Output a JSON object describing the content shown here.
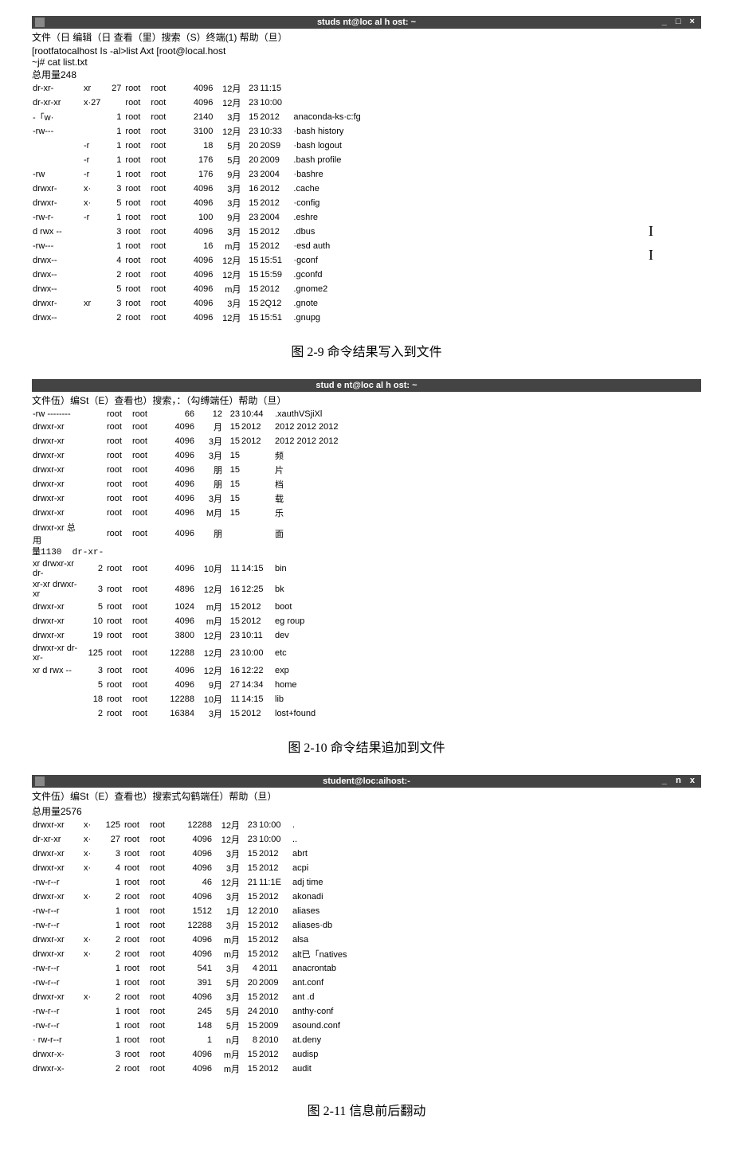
{
  "figure1": {
    "titlebar": "studs nt@loc al h ost: ~",
    "right_icons": "_ □ ×",
    "menubar": "文件（日  编辑（日  查看（里）搜索（S）终端(1)  帮助（旦）",
    "cmd1": "[rootfatocalhost Is -al>list Axt [root@local.host",
    "cmd2": "~j# cat list.txt",
    "total": "总用量248",
    "rows": [
      {
        "perm": "dr-xr-",
        "dot": "xr",
        "lnk": "27",
        "own": "root",
        "grp": "root",
        "size": "4096",
        "mon": "12月",
        "day": "23",
        "time": "11:15",
        "name": ""
      },
      {
        "perm": "dr-xr-xr",
        "dot": "x·27",
        "lnk": "",
        "own": "root",
        "grp": "root",
        "size": "4096",
        "mon": "12月",
        "day": "23",
        "time": "10:00",
        "name": ""
      },
      {
        "perm": "-「w·",
        "dot": "",
        "lnk": "1",
        "own": "root",
        "grp": "root",
        "size": "2140",
        "mon": "3月",
        "day": "15",
        "time": "2012",
        "name": "anaconda-ks·c:fg"
      },
      {
        "perm": "-rw---",
        "dot": "",
        "lnk": "1",
        "own": "root",
        "grp": "root",
        "size": "3100",
        "mon": "12月",
        "day": "23",
        "time": "10:33",
        "name": "·bash history"
      },
      {
        "perm": "",
        "dot": "-r",
        "lnk": "1",
        "own": "root",
        "grp": "root",
        "size": "18",
        "mon": "5月",
        "day": "20",
        "time": "20S9",
        "name": "·bash logout"
      },
      {
        "perm": "",
        "dot": "-r",
        "lnk": "1",
        "own": "root",
        "grp": "root",
        "size": "176",
        "mon": "5月",
        "day": "20",
        "time": "2009",
        "name": ".bash profile"
      },
      {
        "perm": "-rw",
        "dot": "-r",
        "lnk": "1",
        "own": "root",
        "grp": "root",
        "size": "176",
        "mon": "9月",
        "day": "23",
        "time": "2004",
        "name": "·bashre"
      },
      {
        "perm": "drwxr-",
        "dot": "x·",
        "lnk": "3",
        "own": "root",
        "grp": "root",
        "size": "4096",
        "mon": "3月",
        "day": "16",
        "time": "2012",
        "name": ".cache"
      },
      {
        "perm": "drwxr-",
        "dot": "x·",
        "lnk": "5",
        "own": "root",
        "grp": "root",
        "size": "4096",
        "mon": "3月",
        "day": "15",
        "time": "2012",
        "name": "·config"
      },
      {
        "perm": "-rw-r-",
        "dot": "-r",
        "lnk": "1",
        "own": "root",
        "grp": "root",
        "size": "100",
        "mon": "9月",
        "day": "23",
        "time": "2004",
        "name": ".eshre"
      },
      {
        "perm": "d rwx --",
        "dot": "",
        "lnk": "3",
        "own": "root",
        "grp": "root",
        "size": "4096",
        "mon": "3月",
        "day": "15",
        "time": "2012",
        "name": ".dbus"
      },
      {
        "perm": "-rw---",
        "dot": "",
        "lnk": "1",
        "own": "root",
        "grp": "root",
        "size": "16",
        "mon": "m月",
        "day": "15",
        "time": "2012",
        "name": "·esd auth"
      },
      {
        "perm": "drwx--",
        "dot": "",
        "lnk": "4",
        "own": "root",
        "grp": "root",
        "size": "4096",
        "mon": "12月",
        "day": "15",
        "time": "15:51",
        "name": "·gconf"
      },
      {
        "perm": "drwx--",
        "dot": "",
        "lnk": "2",
        "own": "root",
        "grp": "root",
        "size": "4096",
        "mon": "12月",
        "day": "15",
        "time": "15:59",
        "name": ".gconfd"
      },
      {
        "perm": "drwx--",
        "dot": "",
        "lnk": "5",
        "own": "root",
        "grp": "root",
        "size": "4096",
        "mon": "m月",
        "day": "15",
        "time": "2012",
        "name": ".gnome2"
      },
      {
        "perm": "drwxr-",
        "dot": "xr",
        "lnk": "3",
        "own": "root",
        "grp": "root",
        "size": "4096",
        "mon": "3月",
        "day": "15",
        "time": "2Q12",
        "name": ".gnote"
      },
      {
        "perm": "drwx--",
        "dot": "",
        "lnk": "2",
        "own": "root",
        "grp": "root",
        "size": "4096",
        "mon": "12月",
        "day": "15",
        "time": "15:51",
        "name": ".gnupg"
      }
    ],
    "caption": "图 2-9 命令结果写入到文件"
  },
  "figure2": {
    "titlebar": "stud e nt@loc al h ost: ~",
    "menubar": "文件伍）编St（E）查看也）搜索，：（勾缚端任）帮助（旦）",
    "rows_a": [
      {
        "perm": "-rw --------",
        "lnk": "",
        "own": "root",
        "grp": "root",
        "size": "66",
        "mon": "12",
        "day": "23",
        "time": "10:44",
        "name": ".xauthVSjiXl"
      },
      {
        "perm": "drwxr-xr",
        "lnk": "",
        "own": "root",
        "grp": "root",
        "size": "4096",
        "mon": "月",
        "day": "15",
        "time": "2012",
        "name": "2012 2012 2012"
      },
      {
        "perm": "drwxr-xr",
        "lnk": "",
        "own": "root",
        "grp": "root",
        "size": "4096",
        "mon": "3月",
        "day": "15",
        "time": "2012",
        "name": "2012 2012 2012"
      },
      {
        "perm": "drwxr-xr",
        "lnk": "",
        "own": "root",
        "grp": "root",
        "size": "4096",
        "mon": "3月",
        "day": "15",
        "time": "",
        "name": "频"
      },
      {
        "perm": "drwxr-xr",
        "lnk": "",
        "own": "root",
        "grp": "root",
        "size": "4096",
        "mon": "朋",
        "day": "15",
        "time": "",
        "name": "片"
      },
      {
        "perm": "drwxr-xr",
        "lnk": "",
        "own": "root",
        "grp": "root",
        "size": "4096",
        "mon": "朋",
        "day": "15",
        "time": "",
        "name": "档"
      },
      {
        "perm": "drwxr-xr",
        "lnk": "",
        "own": "root",
        "grp": "root",
        "size": "4096",
        "mon": "3月",
        "day": "15",
        "time": "",
        "name": "载"
      },
      {
        "perm": "drwxr-xr",
        "lnk": "",
        "own": "root",
        "grp": "root",
        "size": "4096",
        "mon": "M月",
        "day": "15",
        "time": "",
        "name": "乐"
      },
      {
        "perm": "drwxr-xr 总用",
        "lnk": "",
        "own": "root",
        "grp": "root",
        "size": "4096",
        "mon": "朋",
        "day": "",
        "time": "",
        "name": "面"
      }
    ],
    "mid_line": "量1130  dr-xr-",
    "rows_b": [
      {
        "perm": "xr drwxr-xr dr-",
        "lnk": "2",
        "own": "root",
        "grp": "root",
        "size": "4096",
        "mon": "10月",
        "day": "11",
        "time": "14:15",
        "name": "bin"
      },
      {
        "perm": "xr-xr  drwxr-xr",
        "lnk": "3",
        "own": "root",
        "grp": "root",
        "size": "4896",
        "mon": "12月",
        "day": "16",
        "time": "12:25",
        "name": "bk"
      },
      {
        "perm": "drwxr-xr",
        "lnk": "5",
        "own": "root",
        "grp": "root",
        "size": "1024",
        "mon": "m月",
        "day": "15",
        "time": "2012",
        "name": "boot"
      },
      {
        "perm": "drwxr-xr",
        "lnk": "10",
        "own": "root",
        "grp": "root",
        "size": "4096",
        "mon": "m月",
        "day": "15",
        "time": "2012",
        "name": "eg roup"
      },
      {
        "perm": "drwxr-xr",
        "lnk": "19",
        "own": "root",
        "grp": "root",
        "size": "3800",
        "mon": "12月",
        "day": "23",
        "time": "10:11",
        "name": "dev"
      },
      {
        "perm": "drwxr-xr dr-xr-",
        "lnk": "125",
        "own": "root",
        "grp": "root",
        "size": "12288",
        "mon": "12月",
        "day": "23",
        "time": "10:00",
        "name": "etc"
      },
      {
        "perm": "xr d rwx --",
        "lnk": "3",
        "own": "root",
        "grp": "root",
        "size": "4096",
        "mon": "12月",
        "day": "16",
        "time": "12:22",
        "name": "exp"
      },
      {
        "perm": "",
        "lnk": "5",
        "own": "root",
        "grp": "root",
        "size": "4096",
        "mon": "9月",
        "day": "27",
        "time": "14:34",
        "name": "home"
      },
      {
        "perm": "",
        "lnk": "18",
        "own": "root",
        "grp": "root",
        "size": "12288",
        "mon": "10月",
        "day": "11",
        "time": "14:15",
        "name": "lib"
      },
      {
        "perm": "",
        "lnk": "2",
        "own": "root",
        "grp": "root",
        "size": "16384",
        "mon": "3月",
        "day": "15",
        "time": "2012",
        "name": "lost+found"
      }
    ],
    "caption": "图 2-10 命令结果追加到文件"
  },
  "figure3": {
    "titlebar": "student@loc:aihost:-",
    "right_icons": "_ n x",
    "menubar": "文件伍）编St（E）查看也）搜索式勾鹤端任）帮助（旦）",
    "total": "总用量2576",
    "rows": [
      {
        "perm": "drwxr-xr",
        "dot": "x·",
        "lnk": "125",
        "own": "root",
        "grp": "root",
        "size": "12288",
        "mon": "12月",
        "day": "23",
        "time": "10:00",
        "name": "."
      },
      {
        "perm": "dr-xr-xr",
        "dot": "x·",
        "lnk": "27",
        "own": "root",
        "grp": "root",
        "size": "4096",
        "mon": "12月",
        "day": "23",
        "time": "10:00",
        "name": ".."
      },
      {
        "perm": "drwxr-xr",
        "dot": "x·",
        "lnk": "3",
        "own": "root",
        "grp": "root",
        "size": "4096",
        "mon": "3月",
        "day": "15",
        "time": "2012",
        "name": "abrt"
      },
      {
        "perm": "drwxr-xr",
        "dot": "x·",
        "lnk": "4",
        "own": "root",
        "grp": "root",
        "size": "4096",
        "mon": "3月",
        "day": "15",
        "time": "2012",
        "name": "acpi"
      },
      {
        "perm": "-rw-r--r",
        "dot": "",
        "lnk": "1",
        "own": "root",
        "grp": "root",
        "size": "46",
        "mon": "12月",
        "day": "21",
        "time": "11:1E",
        "name": "adj time"
      },
      {
        "perm": "drwxr-xr",
        "dot": "x·",
        "lnk": "2",
        "own": "root",
        "grp": "root",
        "size": "4096",
        "mon": "3月",
        "day": "15",
        "time": "2012",
        "name": "akonadi"
      },
      {
        "perm": "-rw-r--r",
        "dot": "",
        "lnk": "1",
        "own": "root",
        "grp": "root",
        "size": "1512",
        "mon": "1月",
        "day": "12",
        "time": "2010",
        "name": "aliases"
      },
      {
        "perm": "-rw-r--r",
        "dot": "",
        "lnk": "1",
        "own": "root",
        "grp": "root",
        "size": "12288",
        "mon": "3月",
        "day": "15",
        "time": "2012",
        "name": "aliases·db"
      },
      {
        "perm": "drwxr-xr",
        "dot": "x·",
        "lnk": "2",
        "own": "root",
        "grp": "root",
        "size": "4096",
        "mon": "m月",
        "day": "15",
        "time": "2012",
        "name": "alsa"
      },
      {
        "perm": "drwxr-xr",
        "dot": "x·",
        "lnk": "2",
        "own": "root",
        "grp": "root",
        "size": "4096",
        "mon": "m月",
        "day": "15",
        "time": "2012",
        "name": "alt已「natives"
      },
      {
        "perm": "-rw-r--r",
        "dot": "",
        "lnk": "1",
        "own": "root",
        "grp": "root",
        "size": "541",
        "mon": "3月",
        "day": "4",
        "time": "2011",
        "name": "anacrontab"
      },
      {
        "perm": "-rw-r--r",
        "dot": "",
        "lnk": "1",
        "own": "root",
        "grp": "root",
        "size": "391",
        "mon": "5月",
        "day": "20",
        "time": "2009",
        "name": "ant.conf"
      },
      {
        "perm": "drwxr-xr",
        "dot": "x·",
        "lnk": "2",
        "own": "root",
        "grp": "root",
        "size": "4096",
        "mon": "3月",
        "day": "15",
        "time": "2012",
        "name": "ant .d"
      },
      {
        "perm": "-rw-r--r",
        "dot": "",
        "lnk": "1",
        "own": "root",
        "grp": "root",
        "size": "245",
        "mon": "5月",
        "day": "24",
        "time": "2010",
        "name": "anthy-conf"
      },
      {
        "perm": "-rw-r--r",
        "dot": "",
        "lnk": "1",
        "own": "root",
        "grp": "root",
        "size": "148",
        "mon": "5月",
        "day": "15",
        "time": "2009",
        "name": "asound.conf"
      },
      {
        "perm": "· rw-r--r",
        "dot": "",
        "lnk": "1",
        "own": "root",
        "grp": "root",
        "size": "1",
        "mon": "n月",
        "day": "8",
        "time": "2010",
        "name": "at.deny"
      },
      {
        "perm": "drwxr-x-",
        "dot": "",
        "lnk": "3",
        "own": "root",
        "grp": "root",
        "size": "4096",
        "mon": "m月",
        "day": "15",
        "time": "2012",
        "name": "audisp"
      },
      {
        "perm": "drwxr-x-",
        "dot": "",
        "lnk": "2",
        "own": "root",
        "grp": "root",
        "size": "4096",
        "mon": "m月",
        "day": "15",
        "time": "2012",
        "name": "audit"
      }
    ],
    "caption": "图 2-11 信息前后翻动"
  }
}
